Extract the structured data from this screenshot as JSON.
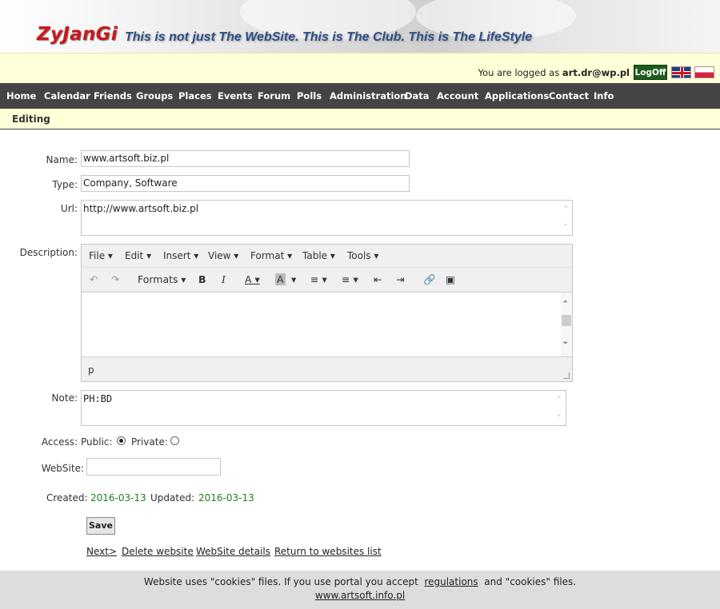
{
  "header": {
    "logo": "ZyJanGi",
    "slogan": "This is not just The WebSite. This is The Club. This is The LifeStyle"
  },
  "login": {
    "prefix": "You are logged as",
    "user": "art.dr@wp.pl",
    "logoff": "LogOff"
  },
  "nav": [
    "Home",
    "Calendar",
    "Friends",
    "Groups",
    "Places",
    "Events",
    "Forum",
    "Polls",
    "Administration",
    "Data",
    "Account",
    "Applications",
    "Contact",
    "Info"
  ],
  "section_title": "Editing",
  "form": {
    "name_label": "Name:",
    "name_value": "www.artsoft.biz.pl",
    "type_label": "Type:",
    "type_value": "Company, Software",
    "url_label": "Url:",
    "url_value": "http://www.artsoft.biz.pl",
    "description_label": "Description:",
    "note_label": "Note:",
    "note_value": "PH:BD",
    "access_label": "Access:",
    "public_label": "Public:",
    "private_label": "Private:",
    "access_selected": "Public",
    "website_label": "WebSite:",
    "website_value": "",
    "created_label": "Created:",
    "created_value": "2016-03-13",
    "updated_label": "Updated:",
    "updated_value": "2016-03-13",
    "save": "Save"
  },
  "editor": {
    "menus": [
      "File",
      "Edit",
      "Insert",
      "View",
      "Format",
      "Table",
      "Tools"
    ],
    "formats": "Formats",
    "bold": "B",
    "italic": "I",
    "status": "p",
    "icons": [
      "undo-icon",
      "redo-icon",
      "bold-icon",
      "italic-icon",
      "text-color-icon",
      "background-color-icon",
      "bullet-list-icon",
      "numbered-list-icon",
      "outdent-icon",
      "indent-icon",
      "link-icon",
      "image-icon"
    ]
  },
  "links": {
    "next": "Next>",
    "delete": "Delete website",
    "details": "WebSite details",
    "return": "Return to websites list"
  },
  "footer": {
    "text1": "Website uses \"cookies\" files. If you use portal you accept",
    "regulations": "regulations",
    "text2": "and \"cookies\" files.",
    "site": "www.artsoft.info.pl"
  }
}
